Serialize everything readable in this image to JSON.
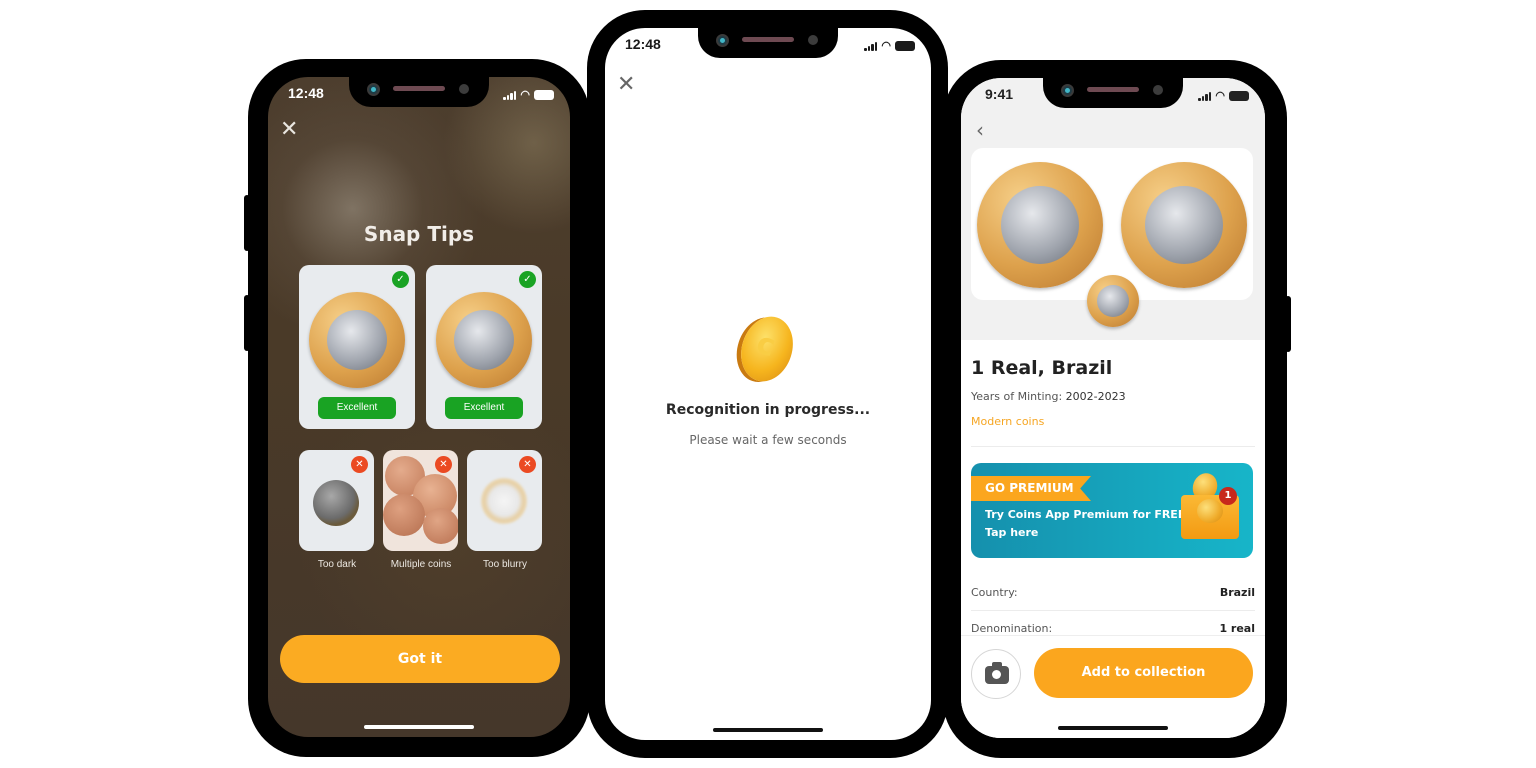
{
  "phones": {
    "snap_tips": {
      "status_time": "12:48",
      "title": "Snap Tips",
      "close_icon": "close-icon",
      "good_examples": [
        {
          "label": "Excellent",
          "status": "check",
          "image": "coin-obverse"
        },
        {
          "label": "Excellent",
          "status": "check",
          "image": "coin-reverse"
        }
      ],
      "bad_examples": [
        {
          "label": "Too dark",
          "status": "cross"
        },
        {
          "label": "Multiple coins",
          "status": "cross"
        },
        {
          "label": "Too blurry",
          "status": "cross"
        }
      ],
      "got_it_label": "Got it"
    },
    "recognition": {
      "status_time": "12:48",
      "close_icon": "close-icon",
      "title": "Recognition in progress...",
      "subtitle": "Please wait a few seconds"
    },
    "coin_detail": {
      "status_time": "9:41",
      "back_icon": "chevron-left-icon",
      "coin_name": "1 Real, Brazil",
      "minting_label": "Years of Minting:",
      "minting_value": "2002-2023",
      "category": "Modern coins",
      "premium": {
        "tag": "GO PREMIUM",
        "line1": "Try Coins App Premium for FREE",
        "line2": "Tap here",
        "notification_count": "1"
      },
      "details": [
        {
          "key": "Country:",
          "value": "Brazil"
        },
        {
          "key": "Denomination:",
          "value": "1 real"
        }
      ],
      "add_button_label": "Add to collection",
      "camera_icon": "camera-icon"
    }
  },
  "colors": {
    "accent": "#fba61e",
    "success": "#1aa324",
    "error": "#eb4a22",
    "premium_banner": "#17b5c9"
  }
}
